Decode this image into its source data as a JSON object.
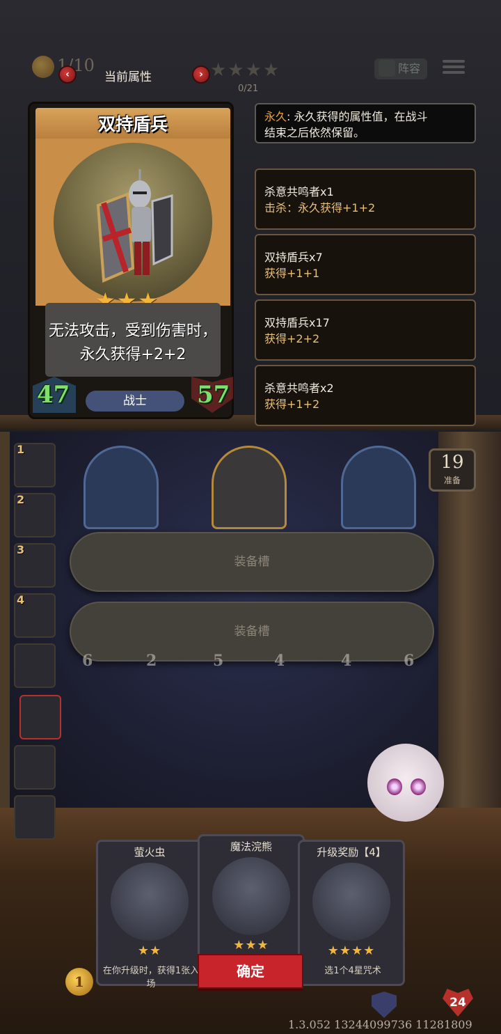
{
  "hud": {
    "coin_text": "1/10",
    "title": "当前属性",
    "prev_icon": "chevron-left-icon",
    "next_icon": "chevron-right-icon",
    "stars": "★★★★",
    "progress": "0/21",
    "team_label": "阵容"
  },
  "card": {
    "name": "双持盾兵",
    "stars": "★★★",
    "description": "无法攻击，受到伤害时，永久获得+2+2",
    "attack": "47",
    "health": "57",
    "class": "战士"
  },
  "info_panels": [
    {
      "tag": "永久",
      "line1_rest": ": 永久获得的属性值，在战斗",
      "line2": "结束之后依然保留。"
    },
    {
      "line1": "杀意共鸣者x1",
      "line2": "击杀：永久获得+1+2"
    },
    {
      "line1": "双持盾兵x7",
      "line2": "获得+1+1"
    },
    {
      "line1": "双持盾兵x17",
      "line2": "获得+2+2"
    },
    {
      "line1": "杀意共鸣者x2",
      "line2": "获得+1+2"
    }
  ],
  "sidebar": {
    "slots": [
      {
        "num": "1"
      },
      {
        "num": "2"
      },
      {
        "num": "3"
      },
      {
        "num": "4"
      },
      {
        "num": ""
      },
      {
        "num": ""
      },
      {
        "num": ""
      },
      {
        "num": ""
      }
    ]
  },
  "board": {
    "ready_count": "19",
    "ready_label": "准备",
    "bottom_stats": [
      "6",
      "2",
      "5",
      "4",
      "4",
      "6"
    ]
  },
  "equip_slots": [
    "装备槽",
    "装备槽"
  ],
  "reward_cards": [
    {
      "title": "萤火虫",
      "stars": "★★",
      "desc": "在你升级时，获得1张入场"
    },
    {
      "title": "魔法浣熊",
      "stars": "★★★",
      "desc": ""
    },
    {
      "title": "升级奖励【4】",
      "stars": "★★★★",
      "desc": "选1个4星咒术"
    }
  ],
  "confirm_label": "确定",
  "coin_bottom": "1",
  "level": "24",
  "version": "1.3.052 13244099736 11281809"
}
